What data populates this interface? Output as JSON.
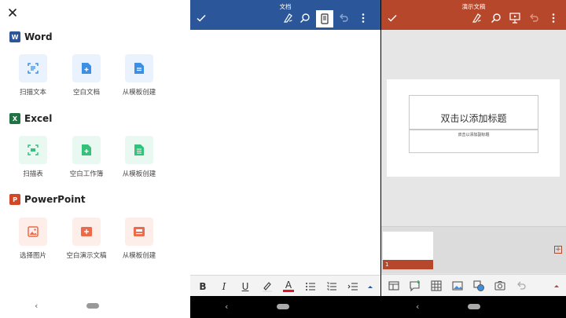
{
  "new_doc_panel": {
    "close_label": "×",
    "sections": [
      {
        "title": "Word",
        "logo_letter": "W",
        "accent": "#2b579a",
        "tile_bg": "#eaf3fd",
        "icon_color": "#3b8fe6",
        "tiles": [
          {
            "label": "扫描文本",
            "icon": "scan-text-icon"
          },
          {
            "label": "空白文档",
            "icon": "blank-document-icon"
          },
          {
            "label": "从模板创建",
            "icon": "template-icon"
          }
        ]
      },
      {
        "title": "Excel",
        "logo_letter": "X",
        "accent": "#217346",
        "tile_bg": "#e9f8f0",
        "icon_color": "#33c27a",
        "tiles": [
          {
            "label": "扫描表",
            "icon": "scan-table-icon"
          },
          {
            "label": "空白工作簿",
            "icon": "blank-workbook-icon"
          },
          {
            "label": "从模板创建",
            "icon": "template-icon"
          }
        ]
      },
      {
        "title": "PowerPoint",
        "logo_letter": "P",
        "accent": "#d24726",
        "tile_bg": "#fdeee9",
        "icon_color": "#ec6a4a",
        "tiles": [
          {
            "label": "选择图片",
            "icon": "picture-icon"
          },
          {
            "label": "空白演示文稿",
            "icon": "blank-presentation-icon"
          },
          {
            "label": "从模板创建",
            "icon": "template-icon"
          }
        ]
      }
    ],
    "nav_back": "‹"
  },
  "word_panel": {
    "title": "文档",
    "bar_color": "#2b579a",
    "format_buttons": [
      {
        "name": "bold-button",
        "label": "B"
      },
      {
        "name": "italic-button",
        "label": "I"
      },
      {
        "name": "underline-button",
        "label": "U"
      }
    ],
    "font_color_label": "A",
    "nav_back": "‹"
  },
  "ppt_panel": {
    "title": "演示文稿",
    "bar_color": "#b7472a",
    "slide_title_placeholder": "双击以添加标题",
    "slide_subtitle_placeholder": "双击以添加副标题",
    "thumbnail_number": "1",
    "add_slide": "+",
    "nav_back": "‹"
  }
}
